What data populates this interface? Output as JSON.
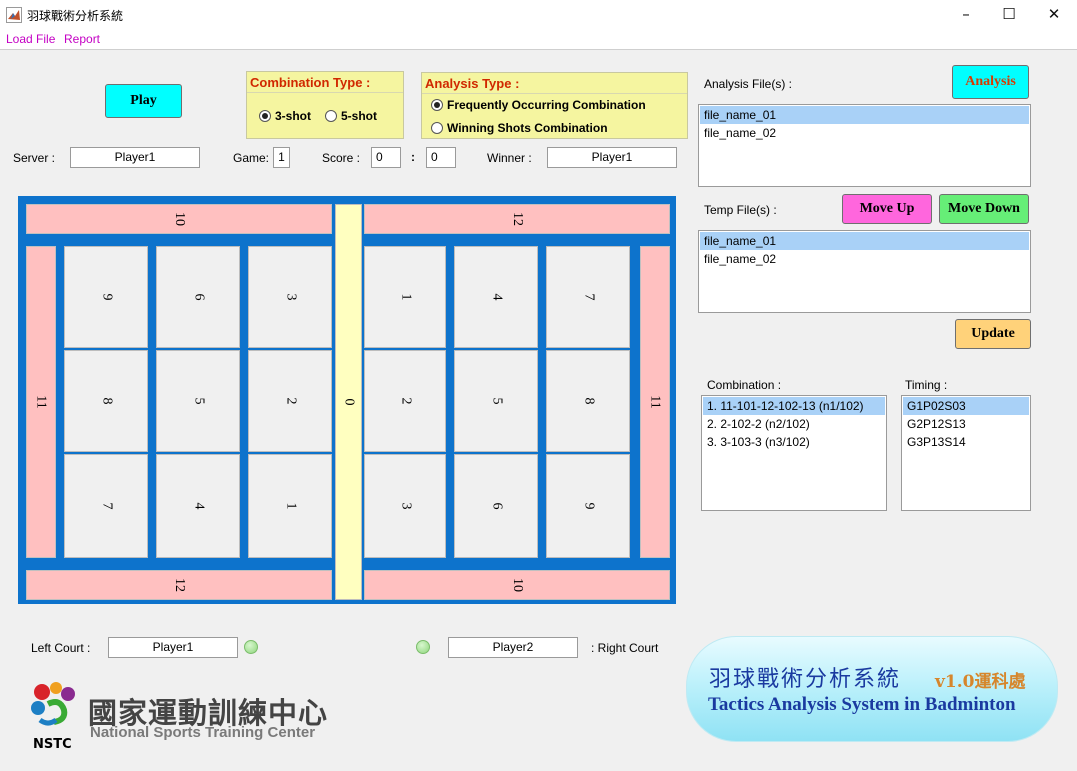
{
  "window": {
    "title": "羽球戰術分析系統"
  },
  "menu": {
    "load_file": "Load File",
    "report": "Report"
  },
  "buttons": {
    "play": "Play",
    "analysis": "Analysis",
    "move_up": "Move Up",
    "move_down": "Move Down",
    "update": "Update"
  },
  "colors": {
    "play": "#00ffff",
    "analysis": "#00ffff",
    "move_up": "#ff66dd",
    "move_down": "#66ee77",
    "update": "#ffd27a",
    "court_blue": "#0d73cc",
    "out_zone": "#ffc0c0",
    "net_zone": "#ffffc0"
  },
  "combination_type": {
    "title": "Combination Type :",
    "options": [
      "3-shot",
      "5-shot"
    ],
    "selected": "3-shot"
  },
  "analysis_type": {
    "title": "Analysis Type :",
    "options": [
      "Frequently Occurring Combination",
      "Winning Shots Combination"
    ],
    "selected": "Frequently Occurring Combination"
  },
  "match": {
    "server_label": "Server :",
    "server": "Player1",
    "game_label": "Game:",
    "game": "1",
    "score_label": "Score :",
    "score_left": "0",
    "score_sep": ":",
    "score_right": "0",
    "winner_label": "Winner :",
    "winner": "Player1"
  },
  "analysis_files": {
    "label": "Analysis File(s) :",
    "items": [
      "file_name_01",
      "file_name_02"
    ],
    "selected_index": 0
  },
  "temp_files": {
    "label": "Temp File(s) :",
    "items": [
      "file_name_01",
      "file_name_02"
    ],
    "selected_index": 0
  },
  "combination": {
    "label": "Combination :",
    "items": [
      "1. 11-101-12-102-13 (n1/102)",
      "2. 2-102-2 (n2/102)",
      "3. 3-103-3 (n3/102)"
    ],
    "selected_index": 0
  },
  "timing": {
    "label": "Timing :",
    "items": [
      "G1P02S03",
      "G2P12S13",
      "G3P13S14"
    ],
    "selected_index": 0
  },
  "court": {
    "top_left": "10",
    "top_right": "12",
    "bottom_left": "12",
    "bottom_right": "10",
    "left_side": "11",
    "right_side": "11",
    "center": "0",
    "left_grid": [
      [
        "9",
        "6",
        "3"
      ],
      [
        "8",
        "5",
        "2"
      ],
      [
        "7",
        "4",
        "1"
      ]
    ],
    "right_grid": [
      [
        "1",
        "4",
        "7"
      ],
      [
        "2",
        "5",
        "8"
      ],
      [
        "3",
        "6",
        "9"
      ]
    ]
  },
  "players": {
    "left_label": "Left Court :",
    "left": "Player1",
    "right": "Player2",
    "right_label": ": Right Court"
  },
  "logo": {
    "cn": "國家運動訓練中心",
    "en": "National Sports Training Center",
    "abbr": "NSTC"
  },
  "banner": {
    "cn": "羽球戰術分析系統",
    "version": "v1.0運科處",
    "en": "Tactics Analysis System in Badminton"
  }
}
